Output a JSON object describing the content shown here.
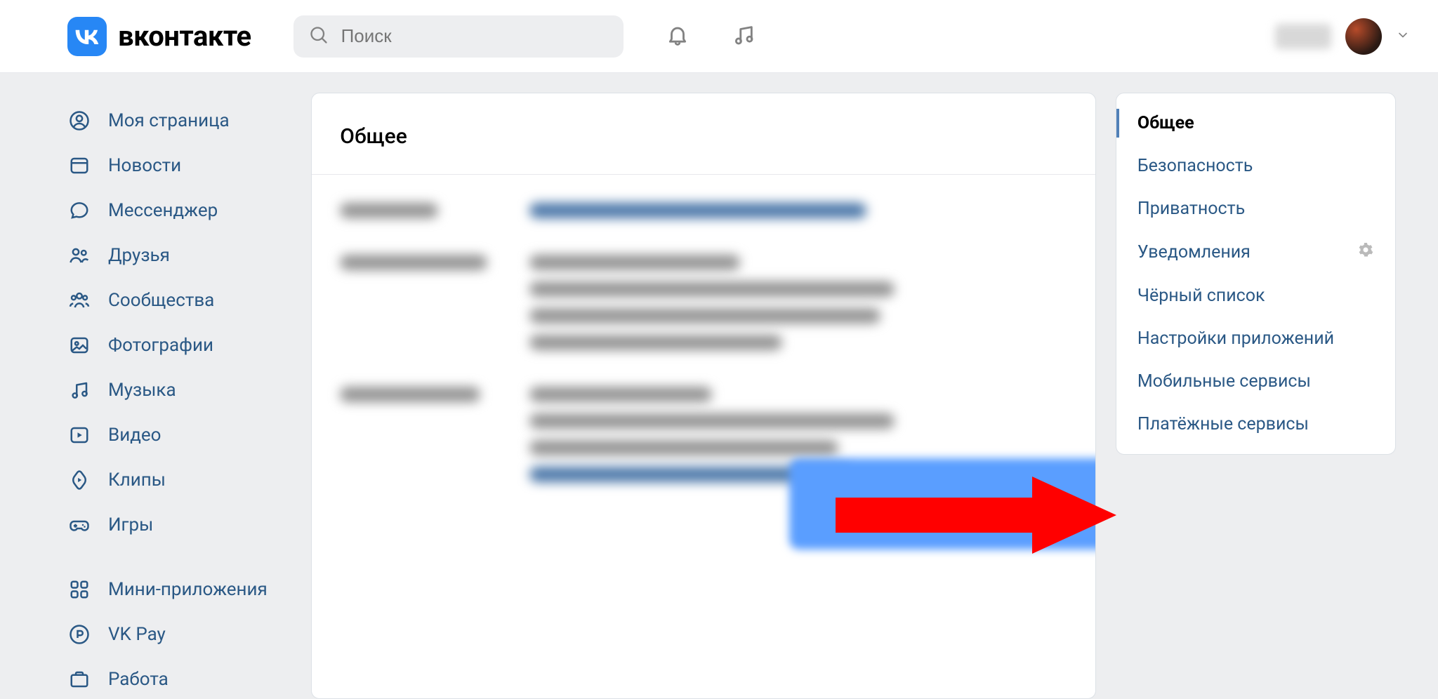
{
  "brand": "вконтакте",
  "search": {
    "placeholder": "Поиск"
  },
  "left_nav": {
    "items": [
      {
        "label": "Моя страница"
      },
      {
        "label": "Новости"
      },
      {
        "label": "Мессенджер"
      },
      {
        "label": "Друзья"
      },
      {
        "label": "Сообщества"
      },
      {
        "label": "Фотографии"
      },
      {
        "label": "Музыка"
      },
      {
        "label": "Видео"
      },
      {
        "label": "Клипы"
      },
      {
        "label": "Игры"
      }
    ],
    "secondary": [
      {
        "label": "Мини-приложения"
      },
      {
        "label": "VK Pay"
      },
      {
        "label": "Работа"
      }
    ]
  },
  "center": {
    "title": "Общее"
  },
  "right_nav": {
    "items": [
      {
        "label": "Общее",
        "active": true
      },
      {
        "label": "Безопасность"
      },
      {
        "label": "Приватность"
      },
      {
        "label": "Уведомления",
        "gear": true
      },
      {
        "label": "Чёрный список"
      },
      {
        "label": "Настройки приложений"
      },
      {
        "label": "Мобильные сервисы"
      },
      {
        "label": "Платёжные сервисы"
      }
    ]
  }
}
